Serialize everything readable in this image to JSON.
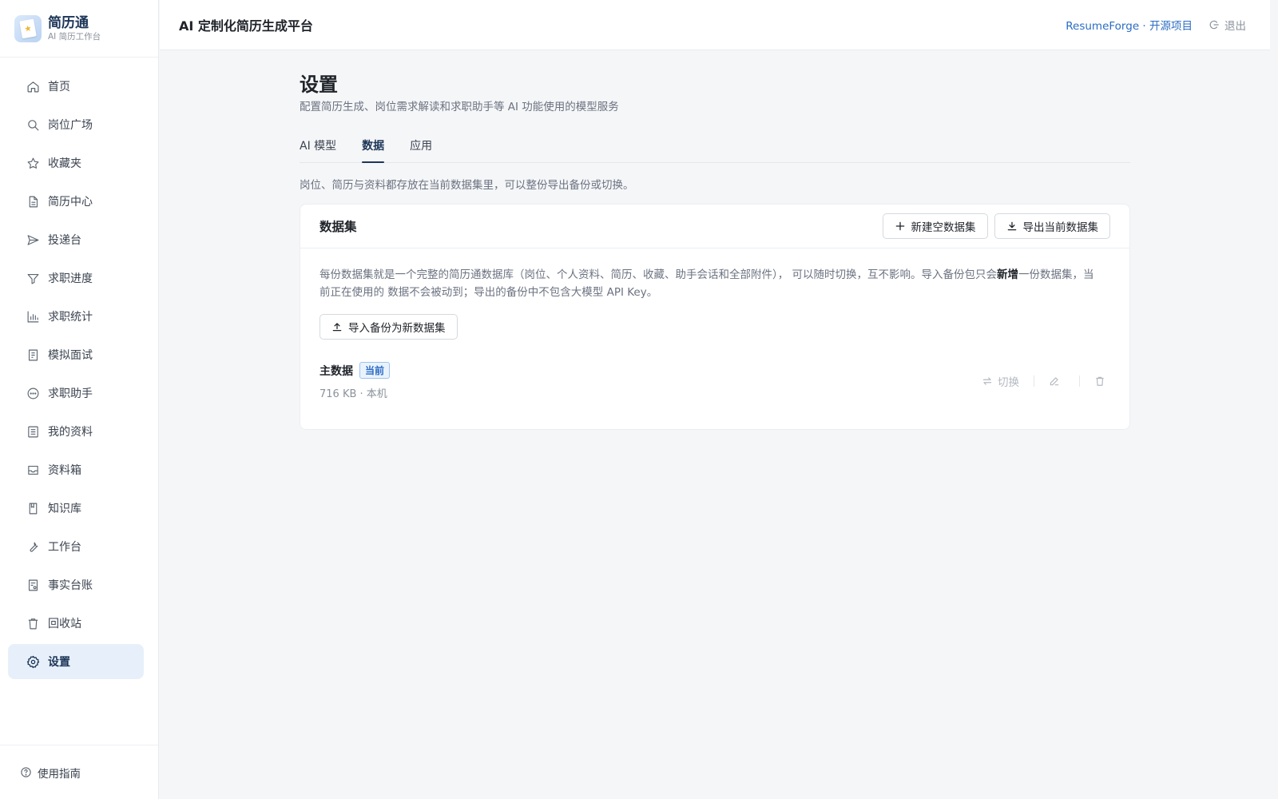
{
  "brand": {
    "name": "简历通",
    "subtitle": "AI 简历工作台"
  },
  "sidebar": {
    "items": [
      {
        "label": "首页",
        "icon": "home-icon"
      },
      {
        "label": "岗位广场",
        "icon": "search-icon"
      },
      {
        "label": "收藏夹",
        "icon": "star-icon"
      },
      {
        "label": "简历中心",
        "icon": "document-icon"
      },
      {
        "label": "投递台",
        "icon": "send-icon"
      },
      {
        "label": "求职进度",
        "icon": "filter-icon"
      },
      {
        "label": "求职统计",
        "icon": "bar-chart-icon"
      },
      {
        "label": "模拟面试",
        "icon": "clipboard-icon"
      },
      {
        "label": "求职助手",
        "icon": "chat-icon"
      },
      {
        "label": "我的资料",
        "icon": "list-icon"
      },
      {
        "label": "资料箱",
        "icon": "inbox-icon"
      },
      {
        "label": "知识库",
        "icon": "book-icon"
      },
      {
        "label": "工作台",
        "icon": "wrench-icon"
      },
      {
        "label": "事实台账",
        "icon": "ledger-icon"
      },
      {
        "label": "回收站",
        "icon": "trash-icon"
      },
      {
        "label": "设置",
        "icon": "gear-icon",
        "active": true
      }
    ],
    "footer_label": "使用指南"
  },
  "header": {
    "title": "AI 定制化简历生成平台",
    "link_label": "ResumeForge · 开源项目",
    "logout_label": "退出"
  },
  "main": {
    "title": "设置",
    "subtitle": "配置简历生成、岗位需求解读和求职助手等 AI 功能使用的模型服务",
    "tabs": [
      {
        "label": "AI 模型"
      },
      {
        "label": "数据",
        "active": true
      },
      {
        "label": "应用"
      }
    ],
    "section_desc": "岗位、简历与资料都存放在当前数据集里，可以整份导出备份或切换。",
    "card": {
      "title": "数据集",
      "new_button": "新建空数据集",
      "export_button": "导出当前数据集",
      "info_part1": "每份数据集就是一个完整的简历通数据库（岗位、个人资料、简历、收藏、助手会话和全部附件）， 可以随时切换，互不影响。导入备份包只会",
      "info_bold": "新增",
      "info_part2": "一份数据集，当前正在使用的 数据不会被动到；导出的备份中不包含大模型 API Key。",
      "import_button": "导入备份为新数据集",
      "dataset": {
        "name": "主数据",
        "badge": "当前",
        "meta": "716 KB · 本机",
        "switch_label": "切换"
      }
    }
  },
  "colors": {
    "accent": "#1d3557",
    "link": "#2b6cc4",
    "active_bg": "#e7f0fa"
  }
}
